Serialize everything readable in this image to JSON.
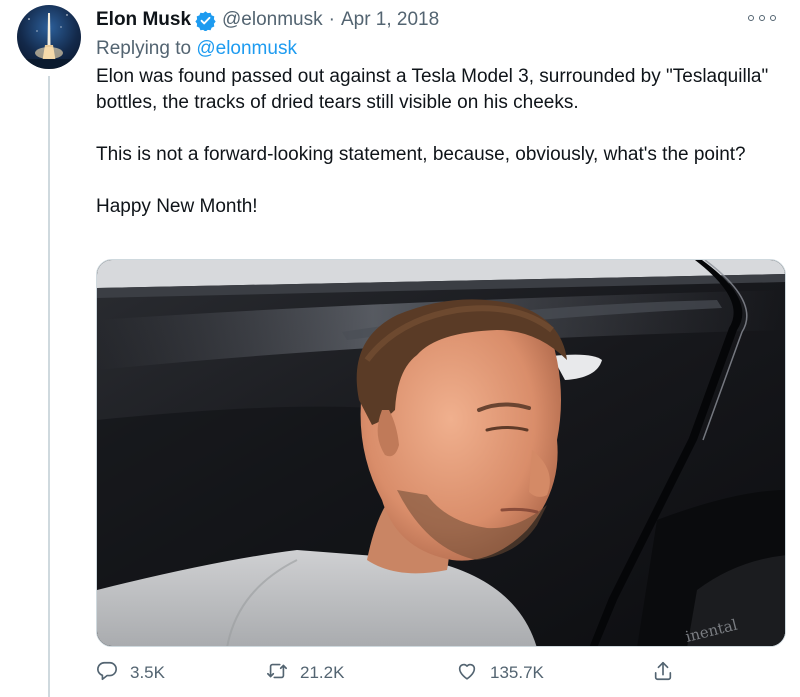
{
  "tweet": {
    "author": {
      "name": "Elon Musk",
      "handle": "@elonmusk",
      "verified": true
    },
    "separator": "·",
    "date": "Apr 1, 2018",
    "reply": {
      "prefix": "Replying to ",
      "handle": "@elonmusk"
    },
    "paragraphs": [
      "Elon was found passed out against a Tesla Model 3, surrounded by \"Teslaquilla\" bottles, the tracks of dried tears still visible on his cheeks.",
      "This is not a forward-looking statement, because, obviously, what's the point?",
      "Happy New Month!"
    ],
    "media_tire_text": "inental"
  },
  "actions": {
    "reply_count": "3.5K",
    "retweet_count": "21.2K",
    "like_count": "135.7K"
  },
  "icons": {
    "verified": "verified-badge-icon",
    "more": "more-options-icon",
    "reply": "reply-icon",
    "retweet": "retweet-icon",
    "like": "heart-icon",
    "share": "share-icon"
  },
  "colors": {
    "accent": "#1d9bf0",
    "secondary_text": "#536471",
    "primary_text": "#0f1419",
    "divider": "#cfd9de"
  }
}
